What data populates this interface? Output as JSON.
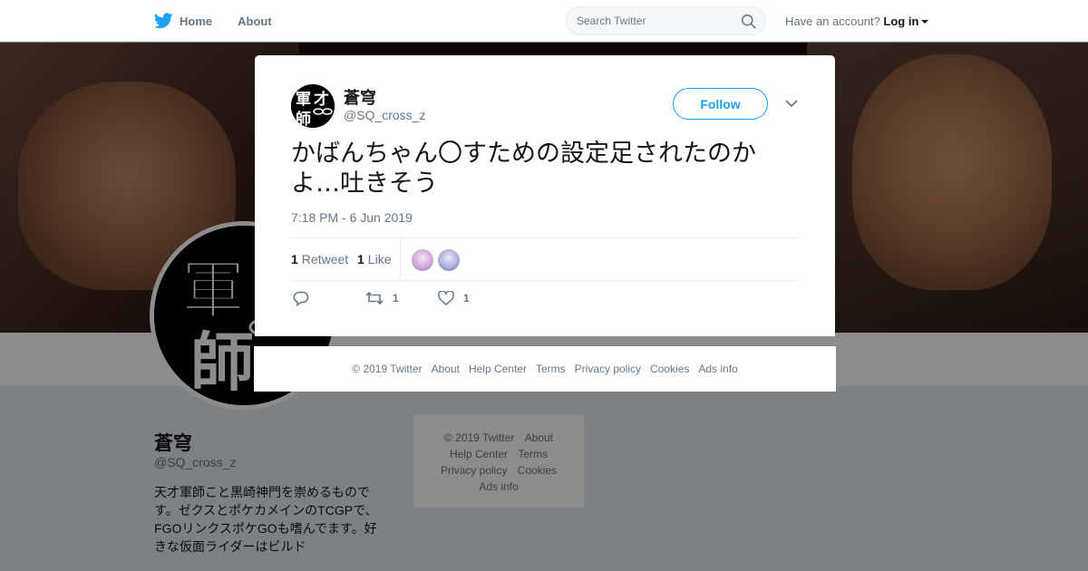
{
  "topbar": {
    "nav": [
      {
        "label": "Home",
        "icon": "twitter-bird-icon"
      },
      {
        "label": "About"
      }
    ],
    "search_placeholder": "Search Twitter",
    "account_prefix": "Have an account?",
    "login_label": "Log in"
  },
  "profile": {
    "name": "蒼穹",
    "handle": "@SQ_cross_z",
    "bio": "天才軍師こと黒崎神門を崇めるものです。ゼクスとポケカメインのTCGPで、FGOリンクスポケGOも嗜んでます。好きな仮面ライダーはビルド",
    "avatar_text": "軍師"
  },
  "side_footer": {
    "items": [
      "© 2019 Twitter",
      "About",
      "Help Center",
      "Terms",
      "Privacy policy",
      "Cookies",
      "Ads info"
    ]
  },
  "tweet": {
    "author_name": "蒼穹",
    "author_handle": "@SQ_cross_z",
    "follow_label": "Follow",
    "text": "かばんちゃん〇すための設定足されたのかよ…吐きそう",
    "timestamp": "7:18 PM - 6 Jun 2019",
    "retweet_count": "1",
    "retweet_label": "Retweet",
    "like_count": "1",
    "like_label": "Like",
    "actions": {
      "reply_icon": "reply-icon",
      "retweet_icon": "retweet-icon",
      "retweet_count": "1",
      "like_icon": "heart-icon",
      "like_count": "1"
    }
  },
  "modal_footer": {
    "items": [
      "© 2019 Twitter",
      "About",
      "Help Center",
      "Terms",
      "Privacy policy",
      "Cookies",
      "Ads info"
    ]
  },
  "colors": {
    "accent": "#1da1f2",
    "secondary_text": "#657786",
    "overlay": "rgba(0,0,0,0.45)"
  }
}
